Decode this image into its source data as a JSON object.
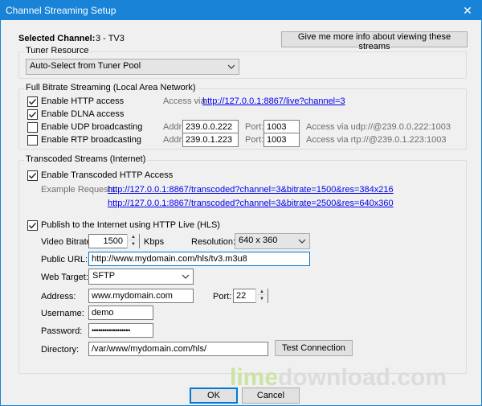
{
  "window": {
    "title": "Channel Streaming Setup",
    "close_glyph": "✕"
  },
  "header": {
    "selected_channel_label": "Selected Channel:",
    "selected_channel_value": "3 - TV3",
    "more_info_button": "Give me more info about viewing these streams"
  },
  "tuner": {
    "group_title": "Tuner Resource",
    "selected": "Auto-Select from Tuner Pool"
  },
  "full_bitrate": {
    "group_title": "Full Bitrate Streaming (Local Area Network)",
    "http": {
      "label": "Enable HTTP access",
      "checked": true,
      "access_prefix": "Access via",
      "access_link": "http://127.0.0.1:8867/live?channel=3"
    },
    "dlna": {
      "label": "Enable DLNA access",
      "checked": true
    },
    "udp": {
      "label": "Enable UDP broadcasting",
      "checked": false,
      "addr_label": "Addr:",
      "addr": "239.0.0.222",
      "port_label": "Port:",
      "port": "1003",
      "access": "Access via udp://@239.0.0.222:1003"
    },
    "rtp": {
      "label": "Enable RTP broadcasting",
      "checked": false,
      "addr_label": "Addr:",
      "addr": "239.0.1.223",
      "port_label": "Port:",
      "port": "1003",
      "access": "Access via rtp://@239.0.1.223:1003"
    }
  },
  "transcoded": {
    "group_title": "Transcoded Streams (Internet)",
    "enable_label": "Enable Transcoded HTTP Access",
    "enable_checked": true,
    "example_label": "Example Requests:",
    "example_1": "http://127.0.0.1:8867/transcoded?channel=3&bitrate=1500&res=384x216",
    "example_2": "http://127.0.0.1:8867/transcoded?channel=3&bitrate=2500&res=640x360",
    "hls_label": "Publish to the Internet using HTTP Live (HLS)",
    "hls_checked": true,
    "video_bitrate_label": "Video Bitrate:",
    "video_bitrate": "1500",
    "kbps": "Kbps",
    "resolution_label": "Resolution:",
    "resolution": "640 x 360",
    "public_url_label": "Public URL:",
    "public_url": "http://www.mydomain.com/hls/tv3.m3u8",
    "web_target_label": "Web Target:",
    "web_target": "SFTP",
    "address_label": "Address:",
    "address": "www.mydomain.com",
    "port_label": "Port:",
    "port": "22",
    "username_label": "Username:",
    "username": "demo",
    "password_label": "Password:",
    "password": "••••••••••••••••••",
    "directory_label": "Directory:",
    "directory": "/var/www/mydomain.com/hls/",
    "test_button": "Test Connection"
  },
  "footer": {
    "ok": "OK",
    "cancel": "Cancel"
  },
  "watermark": {
    "part1": "lime",
    "part2": "download.com"
  },
  "colors": {
    "titlebar": "#1883d7",
    "link": "#0000ee",
    "face": "#f0f0f0"
  }
}
